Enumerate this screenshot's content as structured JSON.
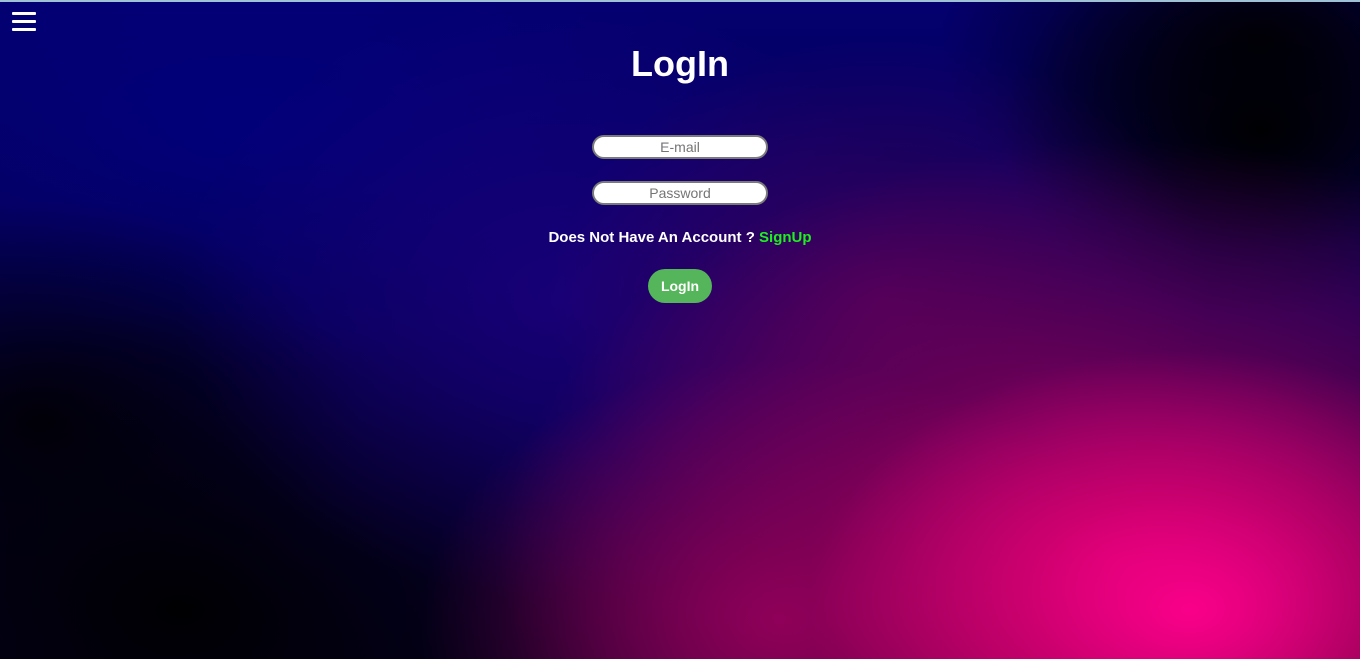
{
  "header": {
    "menu_icon": "hamburger-menu-icon"
  },
  "form": {
    "title": "LogIn",
    "email_placeholder": "E-mail",
    "email_value": "",
    "password_placeholder": "Password",
    "password_value": "",
    "no_account_text": "Does Not Have An Account ?",
    "signup_link": "SignUp",
    "login_button": "LogIn"
  },
  "colors": {
    "signup_link": "#1ef01e",
    "login_button_bg": "#55b55a",
    "background_deep_blue": "#04006e",
    "background_magenta": "#ff008c"
  }
}
